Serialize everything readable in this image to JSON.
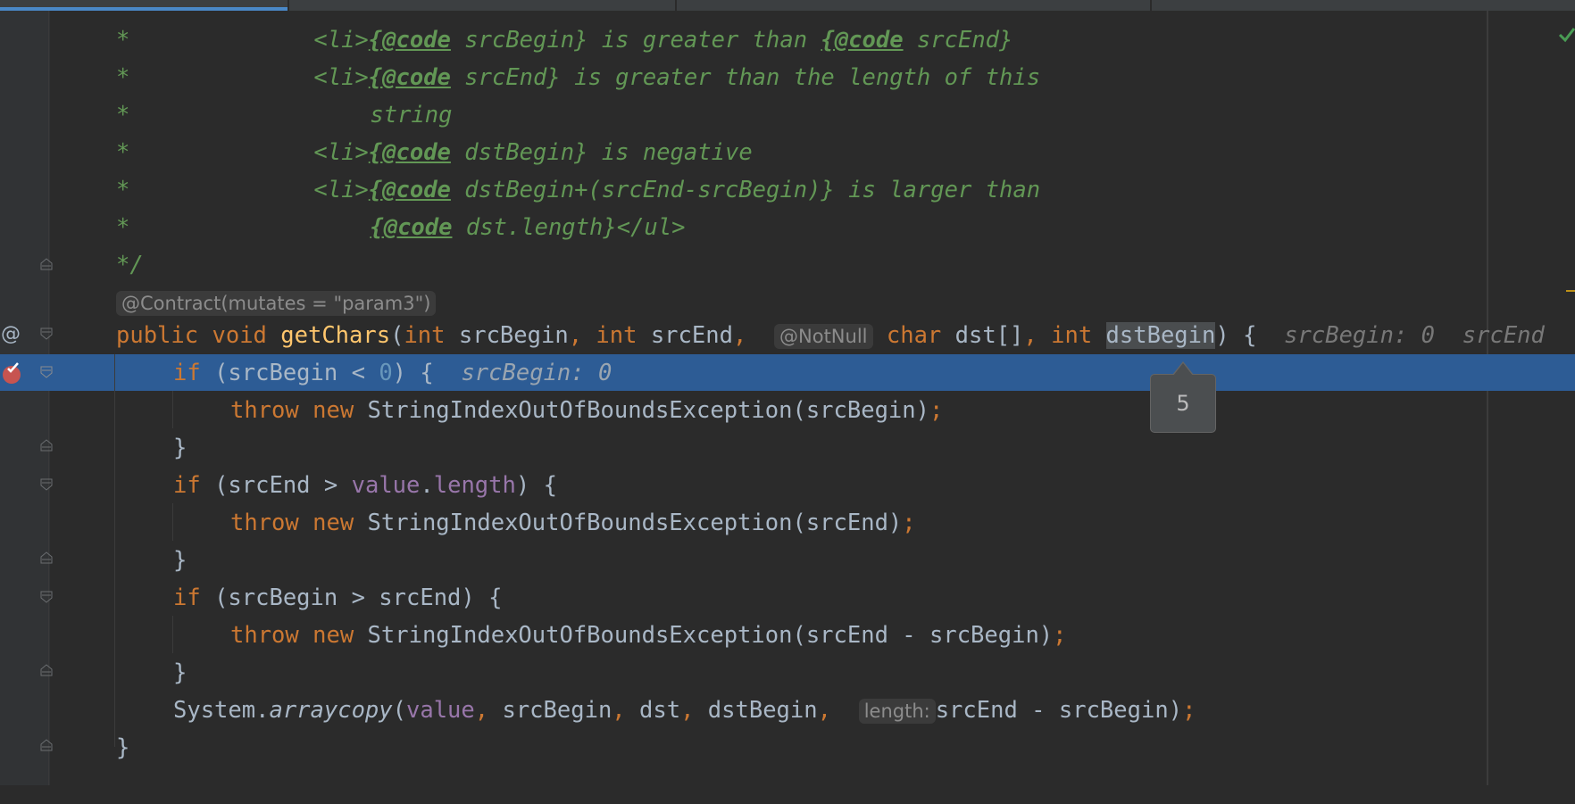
{
  "editor": {
    "lines": [
      {
        "id": "c1",
        "star": "*",
        "tag": "<li>",
        "cmd": "{@code",
        "arg": " srcBegin}",
        "rest": " is greater than ",
        "cmd2": "{@code",
        "arg2": " srcEnd}"
      },
      {
        "id": "c2",
        "star": "*",
        "tag": "<li>",
        "cmd": "{@code",
        "arg": " srcEnd}",
        "rest": " is greater than the length of this"
      },
      {
        "id": "c3",
        "star": "*",
        "text": "string"
      },
      {
        "id": "c4",
        "star": "*",
        "tag": "<li>",
        "cmd": "{@code",
        "arg": " dstBegin}",
        "rest": " is negative"
      },
      {
        "id": "c5",
        "star": "*",
        "tag": "<li>",
        "cmd": "{@code",
        "arg": " dstBegin+(srcEnd-srcBegin)}",
        "rest": " is larger than"
      },
      {
        "id": "c6",
        "star": "*",
        "cmd": "{@code",
        "arg": " dst.length}",
        "tag": "</ul>"
      },
      {
        "id": "c7",
        "close": "*/"
      }
    ],
    "contract_inlay": "@Contract(mutates = \"param3\")",
    "signature": {
      "kw_public": "public",
      "kw_void": "void",
      "name": "getChars",
      "paren": "(",
      "kw_int1": "int",
      "p1": " srcBegin",
      "c1": ",",
      "kw_int2": "int",
      "p2": " srcEnd",
      "c2": ",",
      "notnull": "@NotNull",
      "kw_char": "char",
      "p3": " dst[]",
      "c3": ",",
      "kw_int3": "int",
      "p4": "dstBegin",
      "close": ") {",
      "hint1": "srcBegin: 0",
      "hint2": "srcEnd"
    },
    "if1": {
      "kw": "if",
      "cond_open": " (srcBegin < ",
      "zero": "0",
      "cond_close": ") {",
      "hint": "srcBegin: 0"
    },
    "throw1": {
      "kw_throw": "throw",
      "kw_new": "new",
      "expr": " StringIndexOutOfBoundsException(srcBegin)",
      "semi": ";"
    },
    "brace1": "}",
    "if2": {
      "kw": "if",
      "cond_open": " (srcEnd > ",
      "field": "value",
      "dot": ".",
      "field2": "length",
      "cond_close": ") {"
    },
    "throw2": {
      "kw_throw": "throw",
      "kw_new": "new",
      "expr": " StringIndexOutOfBoundsException(srcEnd)",
      "semi": ";"
    },
    "brace2": "}",
    "if3": {
      "kw": "if",
      "cond": " (srcBegin > srcEnd) {"
    },
    "throw3": {
      "kw_throw": "throw",
      "kw_new": "new",
      "expr": " StringIndexOutOfBoundsException(srcEnd - srcBegin)",
      "semi": ";"
    },
    "brace3": "}",
    "arraycopy": {
      "cls": "System.",
      "method": "arraycopy",
      "open": "(",
      "field": "value",
      "c0": ",",
      "args1": " srcBegin",
      "c1": ",",
      "args2": " dst",
      "c2": ",",
      "args3": " dstBegin",
      "c3": ",",
      "inlay": "length:",
      "args4": "srcEnd - srcBegin",
      "close": ")",
      "semi": ";"
    },
    "method_close": "}",
    "tooltip_value": "5"
  },
  "gutter": {
    "annotation_icon": "@",
    "breakpoint_icon": "breakpoint-icon",
    "fold_icon": "fold-marker-icon"
  },
  "colors": {
    "background": "#2b2b2b",
    "keyword": "#cc7832",
    "comment": "#629755",
    "method": "#ffc66d",
    "field": "#9876aa",
    "selection": "#2d5c95"
  }
}
